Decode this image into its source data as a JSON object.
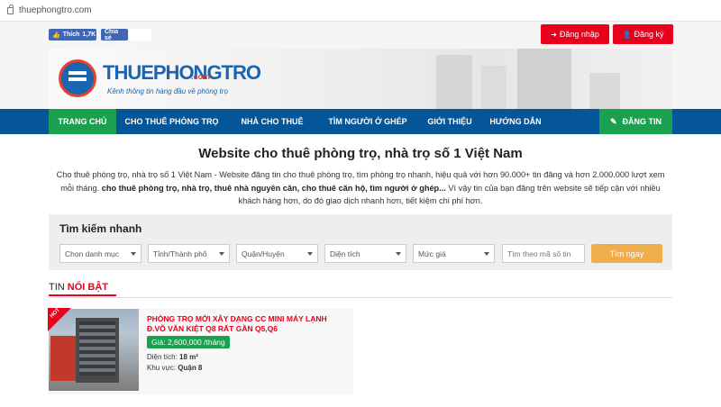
{
  "browser": {
    "url": "thuephongtro.com"
  },
  "social": {
    "like_label": "Thích",
    "like_count": "1,7K",
    "share_label": "Chia sẻ"
  },
  "auth": {
    "login": "Đăng nhập",
    "register": "Đăng ký"
  },
  "logo": {
    "name": "THUEPHONGTRO",
    "tld": ".com",
    "slogan": "Kênh thông tin hàng đầu về phòng trọ"
  },
  "nav": {
    "items": [
      "TRANG CHỦ",
      "CHO THUÊ PHÒNG TRỌ",
      "NHÀ CHO THUÊ",
      "TÌM NGƯỜI Ở GHÉP",
      "GIỚI THIỆU",
      "HƯỚNG DẪN"
    ],
    "post": "ĐĂNG TIN"
  },
  "main": {
    "title": "Website cho thuê phòng trọ, nhà trọ số 1 Việt Nam",
    "intro_1": "Cho thuê phòng trọ, nhà trọ số 1 Việt Nam - Website đăng tin cho thuê phòng trọ, tìm phòng trọ nhanh, hiệu quả với hơn 90.000+ tin đăng và hơn 2.000.000 lượt xem mỗi tháng. ",
    "intro_bold": "cho thuê phòng trọ, nhà trọ, thuê nhà nguyên căn, cho thuê căn hộ, tìm người ở ghép...",
    "intro_2": " Vì vậy tin của bạn đăng trên website sẽ tiếp cận với nhiều khách hàng hơn, do đó giao dịch nhanh hơn, tiết kiệm chi phí hơn."
  },
  "search": {
    "title": "Tìm kiếm nhanh",
    "filters": [
      "Chọn danh mục",
      "Tỉnh/Thành phố",
      "Quận/Huyện",
      "Diện tích",
      "Mức giá"
    ],
    "code_placeholder": "Tìm theo mã số tin",
    "button": "Tìm ngay"
  },
  "featured": {
    "title_prefix": "TIN ",
    "title_highlight": "NỔI BẬT",
    "listing": {
      "badge": "HOT",
      "title": "PHÒNG TRỌ MỚI XÂY DẠNG CC MINI MÁY LẠNH Đ.VÕ VĂN KIỆT Q8 RẤT GẦN Q5,Q6",
      "price": "Giá: 2,600,000 /tháng",
      "area_label": "Diện tích: ",
      "area_value": "18 m²",
      "district_label": "Khu vực: ",
      "district_value": "Quận 8"
    }
  },
  "colors": {
    "nav_blue": "#055699",
    "green": "#1aa150",
    "red": "#e8001c",
    "orange": "#f0ad4e"
  }
}
